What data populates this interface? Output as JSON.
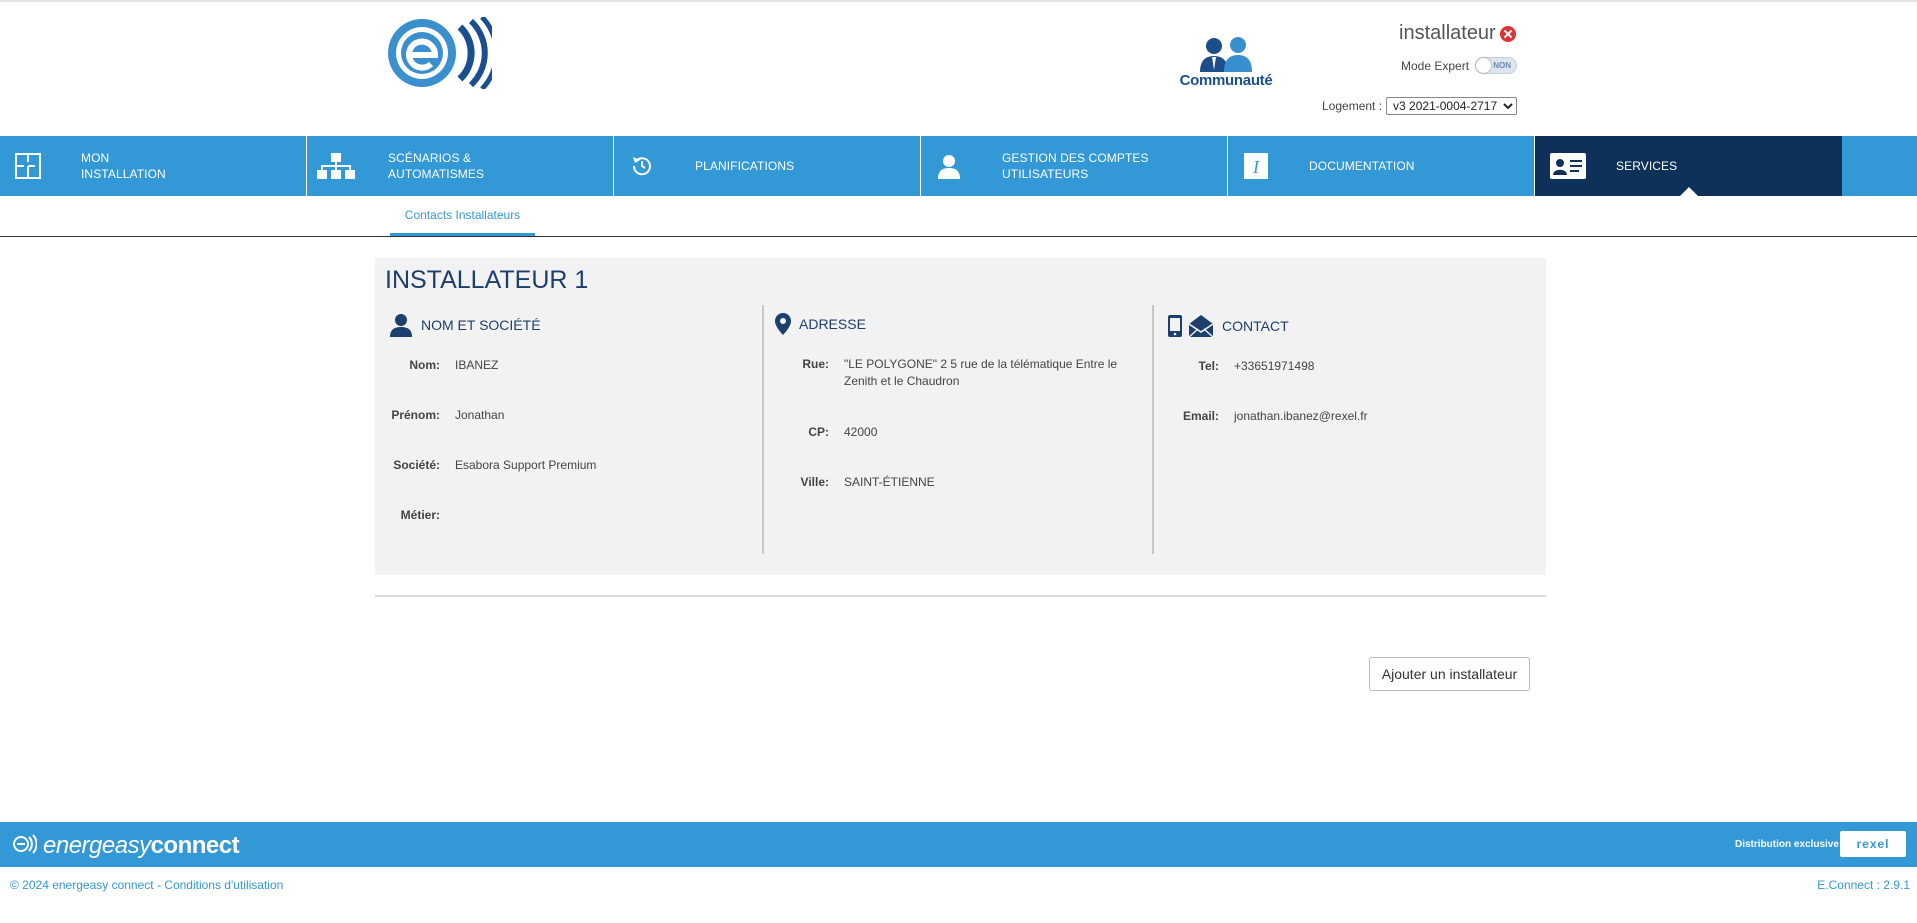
{
  "header": {
    "user_name": "installateur",
    "community_label": "Communauté",
    "expert_label": "Mode Expert",
    "expert_toggle": "NON",
    "logement_label": "Logement :",
    "logement_value": "v3 2021-0004-2717"
  },
  "nav": {
    "items": [
      {
        "label": "MON\nINSTALLATION",
        "icon": "floorplan-icon"
      },
      {
        "label": "SCÉNARIOS &\nAUTOMATISMES",
        "icon": "hierarchy-icon"
      },
      {
        "label": "PLANIFICATIONS",
        "icon": "history-icon"
      },
      {
        "label": "GESTION DES COMPTES\nUTILISATEURS",
        "icon": "user-icon"
      },
      {
        "label": "DOCUMENTATION",
        "icon": "info-icon"
      },
      {
        "label": "SERVICES",
        "icon": "id-card-icon",
        "active": true
      }
    ]
  },
  "subtabs": {
    "contacts": "Contacts Installateurs"
  },
  "card": {
    "title": "INSTALLATEUR 1",
    "identity": {
      "heading": "NOM ET SOCIÉTÉ",
      "nom_label": "Nom:",
      "nom": "IBANEZ",
      "prenom_label": "Prénom:",
      "prenom": "Jonathan",
      "societe_label": "Société:",
      "societe": "Esabora Support Premium",
      "metier_label": "Métier:",
      "metier": ""
    },
    "address": {
      "heading": "ADRESSE",
      "rue_label": "Rue:",
      "rue": "\"LE POLYGONE\" 2 5 rue de la télématique Entre le Zenith et le Chaudron",
      "cp_label": "CP:",
      "cp": "42000",
      "ville_label": "Ville:",
      "ville": "SAINT-ÉTIENNE"
    },
    "contact": {
      "heading": "CONTACT",
      "tel_label": "Tel:",
      "tel": "+33651971498",
      "email_label": "Email:",
      "email": "jonathan.ibanez@rexel.fr"
    }
  },
  "actions": {
    "add_installer": "Ajouter un installateur"
  },
  "footer": {
    "brand_light": "energeasy",
    "brand_bold": "connect",
    "distribution": "Distribution exclusive",
    "partner": "rexel",
    "copyright": "© 2024 energeasy connect - Conditions d'utilisation",
    "version": "E.Connect : 2.9.1"
  },
  "colors": {
    "accent": "#3398d6",
    "nav_active": "#0e3159",
    "heading": "#1c3f6e",
    "logout": "#dd3333"
  }
}
